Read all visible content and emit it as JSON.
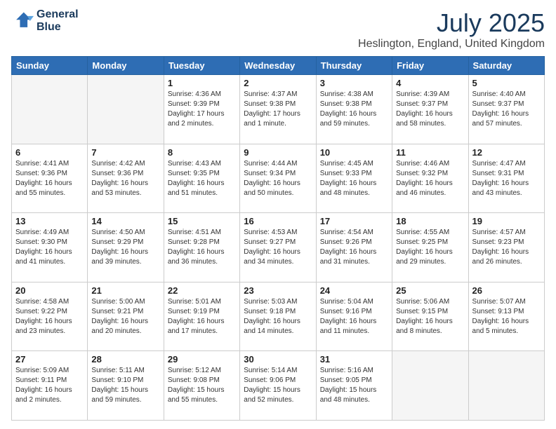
{
  "header": {
    "logo_line1": "General",
    "logo_line2": "Blue",
    "title": "July 2025",
    "subtitle": "Heslington, England, United Kingdom"
  },
  "weekdays": [
    "Sunday",
    "Monday",
    "Tuesday",
    "Wednesday",
    "Thursday",
    "Friday",
    "Saturday"
  ],
  "weeks": [
    [
      {
        "day": "",
        "sunrise": "",
        "sunset": "",
        "daylight": ""
      },
      {
        "day": "",
        "sunrise": "",
        "sunset": "",
        "daylight": ""
      },
      {
        "day": "1",
        "sunrise": "Sunrise: 4:36 AM",
        "sunset": "Sunset: 9:39 PM",
        "daylight": "Daylight: 17 hours and 2 minutes."
      },
      {
        "day": "2",
        "sunrise": "Sunrise: 4:37 AM",
        "sunset": "Sunset: 9:38 PM",
        "daylight": "Daylight: 17 hours and 1 minute."
      },
      {
        "day": "3",
        "sunrise": "Sunrise: 4:38 AM",
        "sunset": "Sunset: 9:38 PM",
        "daylight": "Daylight: 16 hours and 59 minutes."
      },
      {
        "day": "4",
        "sunrise": "Sunrise: 4:39 AM",
        "sunset": "Sunset: 9:37 PM",
        "daylight": "Daylight: 16 hours and 58 minutes."
      },
      {
        "day": "5",
        "sunrise": "Sunrise: 4:40 AM",
        "sunset": "Sunset: 9:37 PM",
        "daylight": "Daylight: 16 hours and 57 minutes."
      }
    ],
    [
      {
        "day": "6",
        "sunrise": "Sunrise: 4:41 AM",
        "sunset": "Sunset: 9:36 PM",
        "daylight": "Daylight: 16 hours and 55 minutes."
      },
      {
        "day": "7",
        "sunrise": "Sunrise: 4:42 AM",
        "sunset": "Sunset: 9:36 PM",
        "daylight": "Daylight: 16 hours and 53 minutes."
      },
      {
        "day": "8",
        "sunrise": "Sunrise: 4:43 AM",
        "sunset": "Sunset: 9:35 PM",
        "daylight": "Daylight: 16 hours and 51 minutes."
      },
      {
        "day": "9",
        "sunrise": "Sunrise: 4:44 AM",
        "sunset": "Sunset: 9:34 PM",
        "daylight": "Daylight: 16 hours and 50 minutes."
      },
      {
        "day": "10",
        "sunrise": "Sunrise: 4:45 AM",
        "sunset": "Sunset: 9:33 PM",
        "daylight": "Daylight: 16 hours and 48 minutes."
      },
      {
        "day": "11",
        "sunrise": "Sunrise: 4:46 AM",
        "sunset": "Sunset: 9:32 PM",
        "daylight": "Daylight: 16 hours and 46 minutes."
      },
      {
        "day": "12",
        "sunrise": "Sunrise: 4:47 AM",
        "sunset": "Sunset: 9:31 PM",
        "daylight": "Daylight: 16 hours and 43 minutes."
      }
    ],
    [
      {
        "day": "13",
        "sunrise": "Sunrise: 4:49 AM",
        "sunset": "Sunset: 9:30 PM",
        "daylight": "Daylight: 16 hours and 41 minutes."
      },
      {
        "day": "14",
        "sunrise": "Sunrise: 4:50 AM",
        "sunset": "Sunset: 9:29 PM",
        "daylight": "Daylight: 16 hours and 39 minutes."
      },
      {
        "day": "15",
        "sunrise": "Sunrise: 4:51 AM",
        "sunset": "Sunset: 9:28 PM",
        "daylight": "Daylight: 16 hours and 36 minutes."
      },
      {
        "day": "16",
        "sunrise": "Sunrise: 4:53 AM",
        "sunset": "Sunset: 9:27 PM",
        "daylight": "Daylight: 16 hours and 34 minutes."
      },
      {
        "day": "17",
        "sunrise": "Sunrise: 4:54 AM",
        "sunset": "Sunset: 9:26 PM",
        "daylight": "Daylight: 16 hours and 31 minutes."
      },
      {
        "day": "18",
        "sunrise": "Sunrise: 4:55 AM",
        "sunset": "Sunset: 9:25 PM",
        "daylight": "Daylight: 16 hours and 29 minutes."
      },
      {
        "day": "19",
        "sunrise": "Sunrise: 4:57 AM",
        "sunset": "Sunset: 9:23 PM",
        "daylight": "Daylight: 16 hours and 26 minutes."
      }
    ],
    [
      {
        "day": "20",
        "sunrise": "Sunrise: 4:58 AM",
        "sunset": "Sunset: 9:22 PM",
        "daylight": "Daylight: 16 hours and 23 minutes."
      },
      {
        "day": "21",
        "sunrise": "Sunrise: 5:00 AM",
        "sunset": "Sunset: 9:21 PM",
        "daylight": "Daylight: 16 hours and 20 minutes."
      },
      {
        "day": "22",
        "sunrise": "Sunrise: 5:01 AM",
        "sunset": "Sunset: 9:19 PM",
        "daylight": "Daylight: 16 hours and 17 minutes."
      },
      {
        "day": "23",
        "sunrise": "Sunrise: 5:03 AM",
        "sunset": "Sunset: 9:18 PM",
        "daylight": "Daylight: 16 hours and 14 minutes."
      },
      {
        "day": "24",
        "sunrise": "Sunrise: 5:04 AM",
        "sunset": "Sunset: 9:16 PM",
        "daylight": "Daylight: 16 hours and 11 minutes."
      },
      {
        "day": "25",
        "sunrise": "Sunrise: 5:06 AM",
        "sunset": "Sunset: 9:15 PM",
        "daylight": "Daylight: 16 hours and 8 minutes."
      },
      {
        "day": "26",
        "sunrise": "Sunrise: 5:07 AM",
        "sunset": "Sunset: 9:13 PM",
        "daylight": "Daylight: 16 hours and 5 minutes."
      }
    ],
    [
      {
        "day": "27",
        "sunrise": "Sunrise: 5:09 AM",
        "sunset": "Sunset: 9:11 PM",
        "daylight": "Daylight: 16 hours and 2 minutes."
      },
      {
        "day": "28",
        "sunrise": "Sunrise: 5:11 AM",
        "sunset": "Sunset: 9:10 PM",
        "daylight": "Daylight: 15 hours and 59 minutes."
      },
      {
        "day": "29",
        "sunrise": "Sunrise: 5:12 AM",
        "sunset": "Sunset: 9:08 PM",
        "daylight": "Daylight: 15 hours and 55 minutes."
      },
      {
        "day": "30",
        "sunrise": "Sunrise: 5:14 AM",
        "sunset": "Sunset: 9:06 PM",
        "daylight": "Daylight: 15 hours and 52 minutes."
      },
      {
        "day": "31",
        "sunrise": "Sunrise: 5:16 AM",
        "sunset": "Sunset: 9:05 PM",
        "daylight": "Daylight: 15 hours and 48 minutes."
      },
      {
        "day": "",
        "sunrise": "",
        "sunset": "",
        "daylight": ""
      },
      {
        "day": "",
        "sunrise": "",
        "sunset": "",
        "daylight": ""
      }
    ]
  ]
}
